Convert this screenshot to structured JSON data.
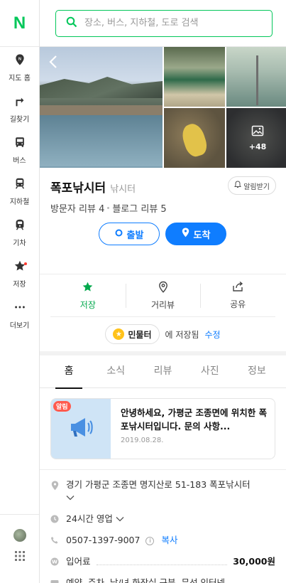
{
  "sidebar": {
    "logo": "N",
    "items": [
      {
        "label": "지도 홈",
        "icon": "map-pin-icon"
      },
      {
        "label": "길찾기",
        "icon": "directions-icon"
      },
      {
        "label": "버스",
        "icon": "bus-icon"
      },
      {
        "label": "지하철",
        "icon": "subway-icon"
      },
      {
        "label": "기차",
        "icon": "train-icon"
      },
      {
        "label": "저장",
        "icon": "star-icon"
      },
      {
        "label": "더보기",
        "icon": "more-icon"
      }
    ]
  },
  "search": {
    "placeholder": "장소, 버스, 지하철, 도로 검색"
  },
  "gallery": {
    "more_count": "+48"
  },
  "place": {
    "name": "폭포낚시터",
    "category": "낚시터",
    "alarm_label": "알림받기",
    "visitor_reviews": "방문자 리뷰 4",
    "blog_reviews": "블로그 리뷰 5"
  },
  "route": {
    "depart": "출발",
    "arrive": "도착"
  },
  "actions": [
    {
      "label": "저장",
      "icon": "star-icon"
    },
    {
      "label": "거리뷰",
      "icon": "streetview-icon"
    },
    {
      "label": "공유",
      "icon": "share-icon"
    }
  ],
  "saved": {
    "folder": "민물터",
    "suffix": "에 저장됨",
    "edit": "수정"
  },
  "tabs": [
    "홈",
    "소식",
    "리뷰",
    "사진",
    "정보"
  ],
  "notice": {
    "badge": "알림",
    "text": "안녕하세요, 가평군 조종면에 위치한 폭포낚시터입니다. 문의 사항...",
    "date": "2019.08.28."
  },
  "details": {
    "address": "경기 가평군 조종면 명지산로 51-183 폭포낚시터",
    "hours": "24시간 영업",
    "phone": "0507-1397-9007",
    "copy": "복사",
    "fee_label": "입어료",
    "fee_value": "30,000원",
    "amenities": "예약, 주차, 남/녀 화장실 구분, 무선 인터넷"
  },
  "colors": {
    "brand": "#03c75a",
    "accent": "#0f7dff",
    "saved_star": "#ffc21a"
  }
}
